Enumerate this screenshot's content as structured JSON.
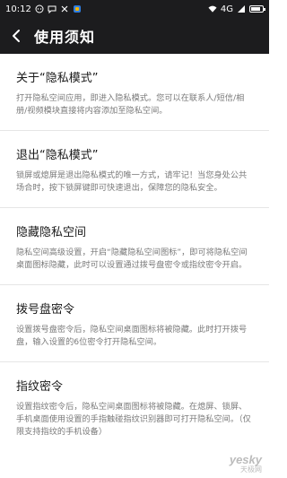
{
  "status_bar": {
    "time": "10:12",
    "network": "4G"
  },
  "header": {
    "title": "使用须知"
  },
  "sections": [
    {
      "title": "关于“隐私模式”",
      "desc": "打开隐私空间应用，即进入隐私模式。您可以在联系人/短信/相册/视频模块直接将内容添加至隐私空间。"
    },
    {
      "title": "退出“隐私模式”",
      "desc": "锁屏或熄屏是退出隐私模式的唯一方式，请牢记！当您身处公共场合时，按下锁屏键即可快速退出，保障您的隐私安全。"
    },
    {
      "title": "隐藏隐私空间",
      "desc": "隐私空间高级设置，开启“隐藏隐私空间图标”，即可将隐私空间桌面图标隐藏，此时可以设置通过拨号盘密令或指纹密令开启。"
    },
    {
      "title": "拨号盘密令",
      "desc": "设置拨号盘密令后，隐私空间桌面图标将被隐藏。此时打开拨号盘，输入设置的6位密令打开隐私空间。"
    },
    {
      "title": "指纹密令",
      "desc": "设置指纹密令后，隐私空间桌面图标将被隐藏。在熄屏、锁屏、手机桌面使用设置的手指触碰指纹识别器即可打开隐私空间。（仅限支持指纹的手机设备）"
    }
  ],
  "watermark": {
    "text": "yesky",
    "sub": "天极网"
  },
  "colors": {
    "bar_bg": "#1c1c1e",
    "title_text": "#1a1a1a",
    "desc_text": "#7a7a7a",
    "divider": "#e6e6e6"
  },
  "icons": [
    "wechat-icon",
    "message-icon",
    "no-signal-icon",
    "app-icon",
    "wifi-icon",
    "signal-icon",
    "battery-icon",
    "back-arrow-icon"
  ]
}
